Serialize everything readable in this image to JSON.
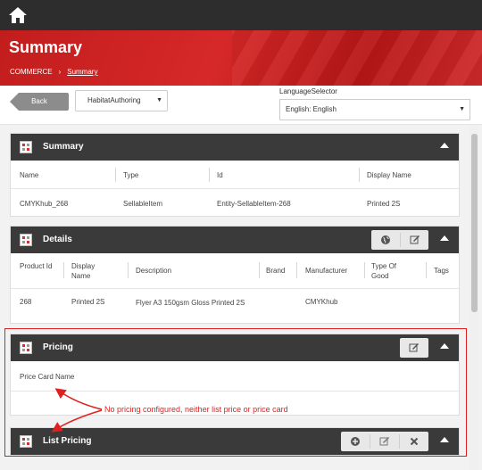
{
  "page": {
    "title": "Summary"
  },
  "breadcrumb": {
    "root": "COMMERCE",
    "separator": "›",
    "current": "Summary"
  },
  "toolbar": {
    "back_label": "Back",
    "database_value": "HabitatAuthoring",
    "language_label": "LanguageSelector",
    "language_value": "English: English"
  },
  "summary": {
    "title": "Summary",
    "headers": [
      "Name",
      "Type",
      "Id",
      "Display Name"
    ],
    "row": [
      "CMYKhub_268",
      "SellableItem",
      "Entity-SellableItem-268",
      "Printed 2S"
    ]
  },
  "details": {
    "title": "Details",
    "headers": [
      "Product Id",
      "Display Name",
      "Description",
      "Brand",
      "Manufacturer",
      "Type Of Good",
      "Tags"
    ],
    "row": [
      "268",
      "Printed 2S",
      "Flyer A3 150gsm Gloss Printed 2S",
      "",
      "CMYKhub",
      "",
      ""
    ]
  },
  "pricing": {
    "title": "Pricing",
    "header": "Price Card Name"
  },
  "list_pricing": {
    "title": "List Pricing"
  },
  "annotation": {
    "text": "No pricing configured, neither list price or price card"
  },
  "icons": {
    "home": "home-icon",
    "panel": "grid-icon",
    "collapse": "chevron-up-icon",
    "globe": "globe-icon",
    "edit": "edit-icon",
    "add": "plus-circle-icon",
    "delete": "close-icon"
  },
  "colors": {
    "header_red": "#d62828",
    "panel_dark": "#3a3a3a",
    "annotation_red": "#e02020"
  }
}
